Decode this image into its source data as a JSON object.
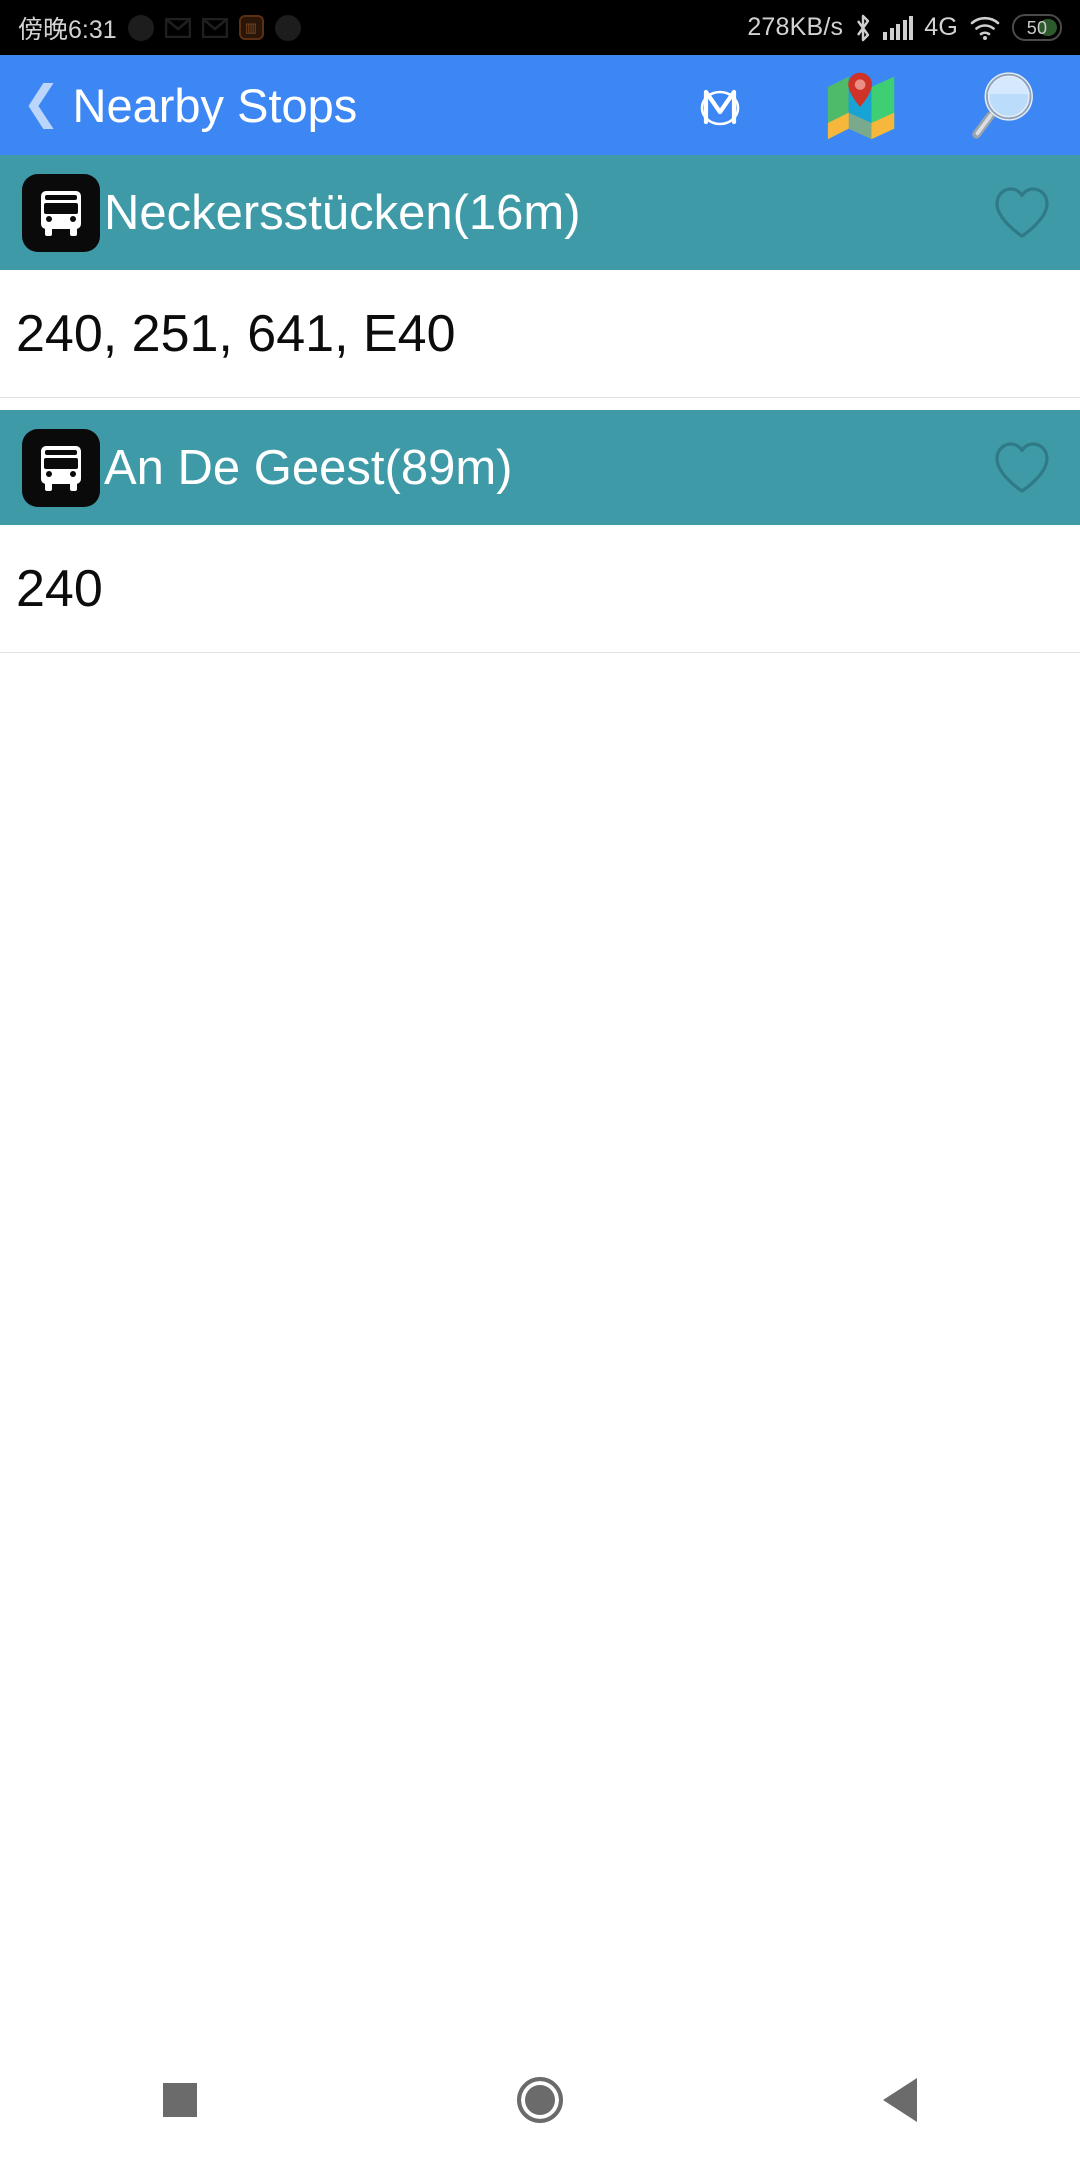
{
  "status_bar": {
    "time": "傍晚6:31",
    "network_speed": "278KB/s",
    "network_type": "4G",
    "battery_level": "50",
    "icons": [
      "record-dot-icon",
      "gmail-icon",
      "gmail-icon",
      "app-badge-icon",
      "record-dot-icon",
      "bluetooth-icon",
      "signal-bars-icon",
      "wifi-icon",
      "battery-icon"
    ]
  },
  "app_bar": {
    "back_label": "❮",
    "title": "Nearby Stops",
    "actions": [
      {
        "name": "metro-icon",
        "label": "M"
      },
      {
        "name": "map-icon",
        "label": "🗺"
      },
      {
        "name": "search-icon",
        "label": "🔍"
      }
    ]
  },
  "stops": [
    {
      "name": "Neckersstücken(16m)",
      "routes": "240, 251, 641, E40",
      "favorite": false,
      "transport_icon": "bus-icon"
    },
    {
      "name": "An De Geest(89m)",
      "routes": "240",
      "favorite": false,
      "transport_icon": "bus-icon"
    }
  ],
  "nav_bar": {
    "recents_label": "recents",
    "home_label": "home",
    "back_label": "back"
  },
  "colors": {
    "app_bar_blue": "#3d87f5",
    "stop_teal": "#3f9aa8",
    "status_black": "#000000",
    "text_white": "#ffffff",
    "routes_black": "#0c0c0c"
  }
}
